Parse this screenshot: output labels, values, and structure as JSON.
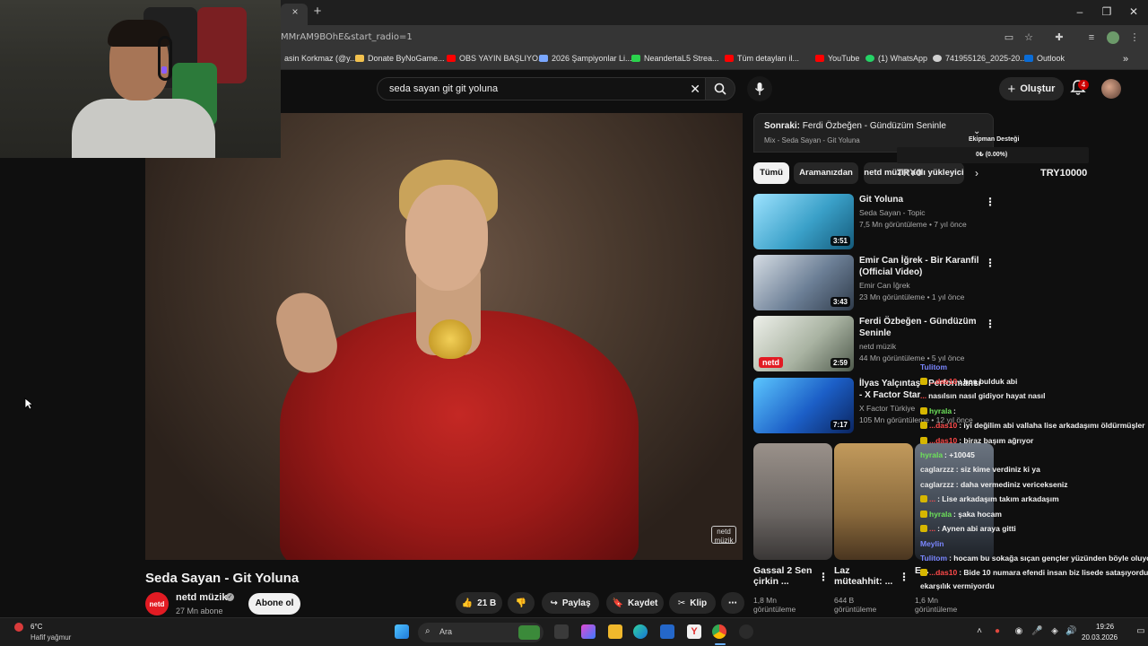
{
  "browser": {
    "url": "MMrAM9BOhE&start_radio=1",
    "close_tab_glyph": "×",
    "new_tab_glyph": "+",
    "bookmarks": [
      {
        "label": "asin Korkmaz (@y...",
        "color": "#ff0000"
      },
      {
        "label": "Donate ByNoGame...",
        "color": "#f2c14e"
      },
      {
        "label": "OBS YAYIN BAŞLIYO...",
        "color": "#ff0000"
      },
      {
        "label": "2026 Şampiyonlar Li...",
        "color": "#7aa7ff"
      },
      {
        "label": "NeandertaL5 Strea...",
        "color": "#2bd34d"
      },
      {
        "label": "Tüm detayları il...",
        "color": "#ff0000"
      },
      {
        "label": "YouTube",
        "color": "#ff0000"
      },
      {
        "label": "(1) WhatsApp",
        "color": "#25d366"
      },
      {
        "label": "741955126_2025-20...",
        "color": "#d0d0d0"
      },
      {
        "label": "Outlook",
        "color": "#0a6cd6"
      }
    ]
  },
  "youtube": {
    "search_query": "seda sayan git git yoluna",
    "create_label": "Oluştur",
    "notification_count": "4",
    "video": {
      "title": "Seda Sayan - Git Yoluna",
      "channel": "netd müzik",
      "channel_logo": "netd",
      "subscribers": "27 Mn abone",
      "subscribe_label": "Abone ol",
      "likes": "21 B",
      "share_label": "Paylaş",
      "save_label": "Kaydet",
      "clip_label": "Klip",
      "watermark": "netd müzik"
    },
    "up_next": {
      "prefix": "Sonraki:",
      "title": "Ferdi Özbeğen - Gündüzüm Seninle",
      "mix": "Mix - Seda Sayan - Git Yoluna"
    },
    "chips": [
      "Tümü",
      "Aramanızdan",
      "netd müzik adlı yükleyici"
    ],
    "recommendations": [
      {
        "title": "Git Yoluna",
        "channel": "Seda Sayan - Topic",
        "meta": "7,5 Mn görüntüleme • 7 yıl önce",
        "duration": "3:51",
        "thumb_color": "#3aa0c8"
      },
      {
        "title": "Emir Can İğrek - Bir Karanfil (Official Video)",
        "channel": "Emir Can İğrek",
        "meta": "23 Mn görüntüleme • 1 yıl önce",
        "duration": "3:43",
        "thumb_color": "#6c7f96"
      },
      {
        "title": "Ferdi Özbeğen - Gündüzüm Seninle",
        "channel": "netd müzik",
        "meta": "44 Mn görüntüleme • 5 yıl önce",
        "duration": "2:59",
        "thumb_color": "#a9b3a2"
      },
      {
        "title": "İlyas Yalçıntaş - Performansı - X Factor Star",
        "channel": "X Factor Türkiye",
        "meta": "105 Mn görüntüleme • 12 yıl önce",
        "duration": "7:17",
        "thumb_color": "#1c5fc7"
      }
    ],
    "shorts": [
      {
        "title": "Gassal 2 Sen çirkin ...",
        "views": "1,8 Mn görüntüleme",
        "color": "#6b6663"
      },
      {
        "title": "Laz müteahhit: ...",
        "views": "644 B görüntüleme",
        "color": "#8a6a3c"
      },
      {
        "title": "E...",
        "views": "1,6 Mn görüntüleme",
        "color": "#3d4550"
      }
    ]
  },
  "overlay": {
    "donation_label": "Ekipman Desteği",
    "donation_progress": "0₺ (0.00%)",
    "donation_min": "TRY0",
    "donation_max": "TRY10000",
    "chat": [
      {
        "user": "Tulitom",
        "text": "",
        "color": "#7a86ff"
      },
      {
        "user": "...das10",
        "text": ": hoş bulduk abi",
        "color": "#ff4a4a"
      },
      {
        "user": "...",
        "text": "nasılsın nasıl gidiyor hayat nasıl",
        "color": "#ff4a4a"
      },
      {
        "user": "hyrala",
        "text": ":",
        "color": "#6ee35a"
      },
      {
        "user": "...das10",
        "text": ": iyi değilim abi vallaha lise arkadaşımı öldürmüşler",
        "color": "#ff4a4a"
      },
      {
        "user": "...das10",
        "text": ": biraz başım ağrıyor",
        "color": "#ff4a4a"
      },
      {
        "user": "hyrala",
        "text": ": +10045",
        "color": "#6ee35a"
      },
      {
        "user": "caglarzzz",
        "text": ": siz kime verdiniz ki ya",
        "color": "#e7e7e7"
      },
      {
        "user": "caglarzzz",
        "text": ": daha vermediniz vericekseniz",
        "color": "#e7e7e7"
      },
      {
        "user": "...",
        "text": ": Lise arkadaşım takım arkadaşım",
        "color": "#ff4a4a"
      },
      {
        "user": "hyrala",
        "text": ": şaka hocam",
        "color": "#6ee35a"
      },
      {
        "user": "...",
        "text": ": Aynen abi araya gitti",
        "color": "#ff4a4a"
      },
      {
        "user": "Meylin",
        "text": "",
        "color": "#7a86ff"
      },
      {
        "user": "Tulitom",
        "text": ": hocam bu sokağa sıçan gençler yüzünden böyle oluyo",
        "color": "#7a86ff"
      },
      {
        "user": "...das10",
        "text": ": Bide 10 numara efendi insan biz lisede sataşıyordu",
        "color": "#ff4a4a"
      },
      {
        "user": "",
        "text": "ekarşılık vermiyordu",
        "color": "#f1f1f1"
      }
    ]
  },
  "taskbar": {
    "temperature": "6°C",
    "weather": "Hafif yağmur",
    "search_placeholder": "Ara",
    "time": "19:26",
    "date": "20.03.2026"
  }
}
